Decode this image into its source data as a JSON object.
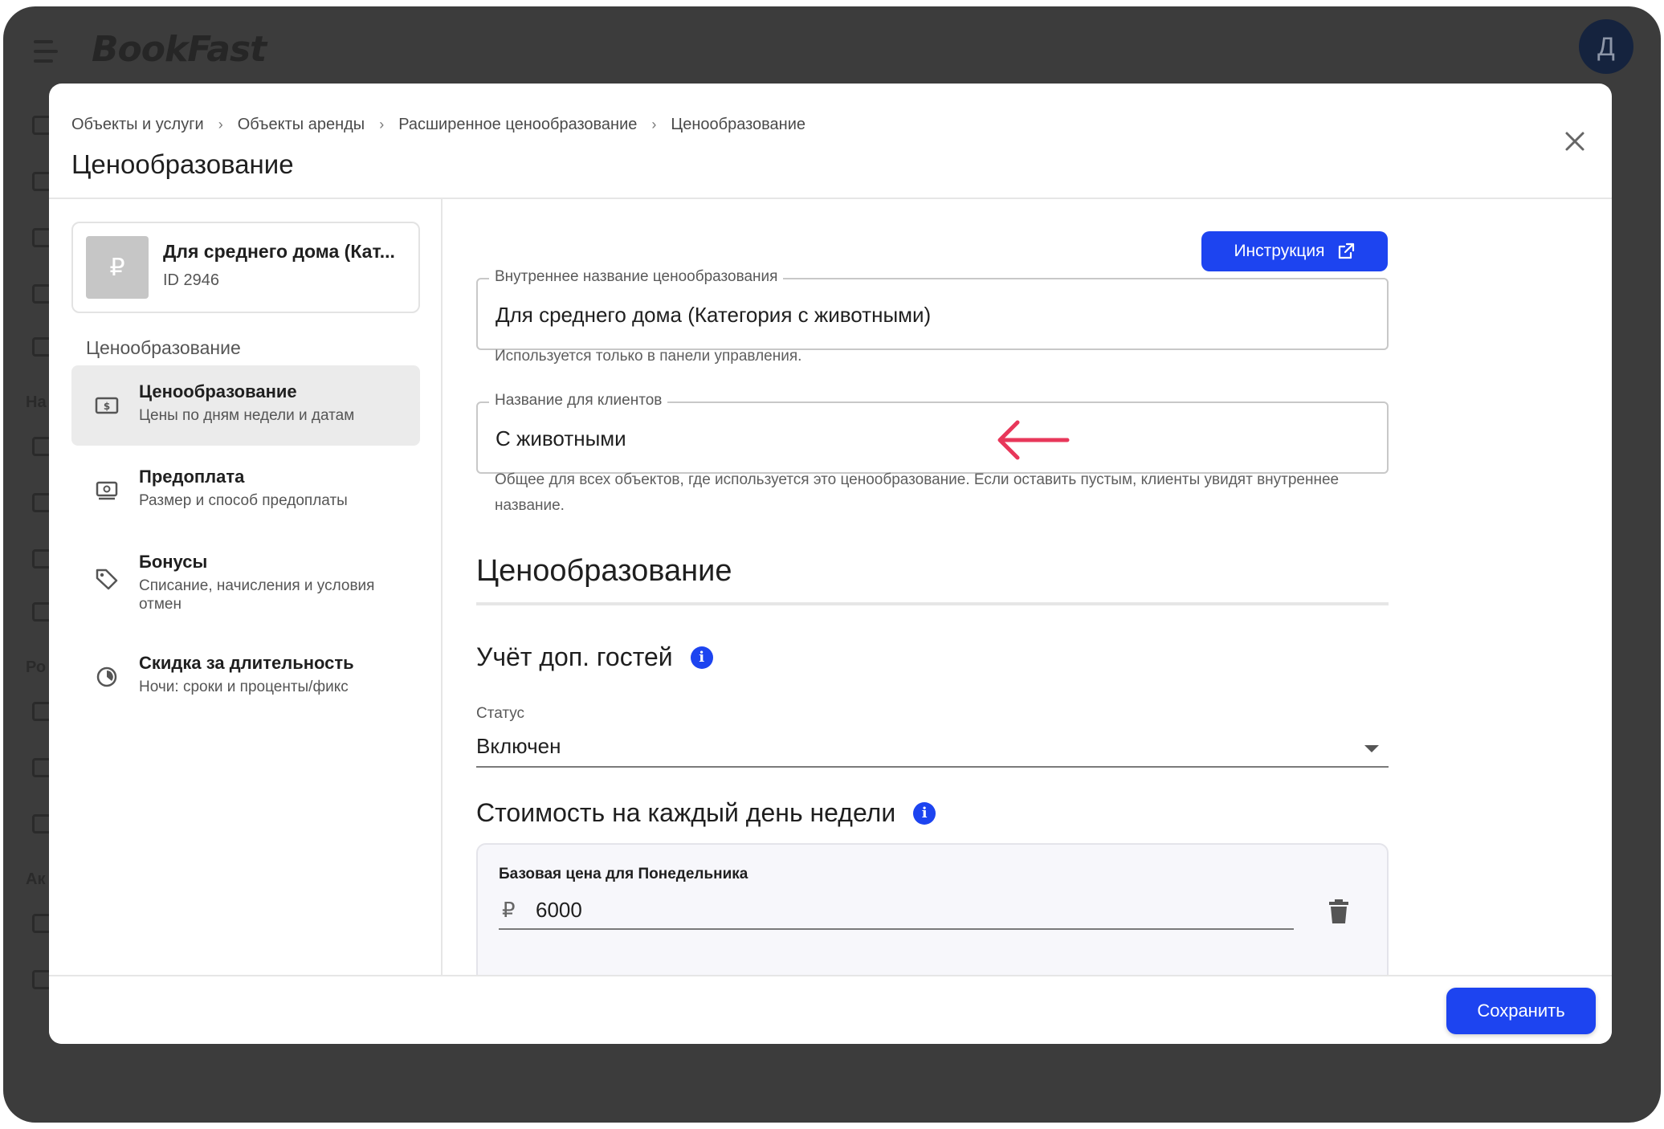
{
  "app": {
    "logo": "BookFast",
    "avatar_letter": "Д"
  },
  "background_sidebar": {
    "labels": [
      "На",
      "Ро",
      "Ак"
    ]
  },
  "breadcrumb": [
    "Объекты и услуги",
    "Объекты аренды",
    "Расширенное ценообразование",
    "Ценообразование"
  ],
  "page_title": "Ценообразование",
  "object": {
    "name": "Для среднего дома (Кат...",
    "id": "ID 2946",
    "thumb_symbol": "₽"
  },
  "sidebar": {
    "heading": "Ценообразование",
    "items": [
      {
        "title": "Ценообразование",
        "subtitle": "Цены по дням недели и датам",
        "icon": "price-tag-icon",
        "active": true
      },
      {
        "title": "Предоплата",
        "subtitle": "Размер и способ предоплаты",
        "icon": "cash-icon",
        "active": false
      },
      {
        "title": "Бонусы",
        "subtitle": "Списание, начисления и условия отмен",
        "icon": "tag-icon",
        "active": false
      },
      {
        "title": "Скидка за длительность",
        "subtitle": "Ночи: сроки и проценты/фикс",
        "icon": "clock-discount-icon",
        "active": false
      }
    ]
  },
  "instruction_button": "Инструкция",
  "internal_name": {
    "label": "Внутреннее название ценообразования",
    "value": "Для среднего дома (Категория с животными)",
    "helper": "Используется только в панели управления."
  },
  "client_name": {
    "label": "Название для клиентов",
    "value": "С животными",
    "helper": "Общее для всех объектов, где используется это ценообразование. Если оставить пустым, клиенты увидят внутреннее название."
  },
  "section_title": "Ценообразование",
  "extra_guests": {
    "title": "Учёт доп. гостей",
    "status_label": "Статус",
    "status_value": "Включен"
  },
  "weekday_cost": {
    "title": "Стоимость на каждый день недели",
    "monday_label": "Базовая цена для Понедельника",
    "currency": "₽",
    "monday_value": "6000"
  },
  "save_button": "Сохранить",
  "colors": {
    "accent": "#1d44f0",
    "arrow": "#e8375a"
  }
}
